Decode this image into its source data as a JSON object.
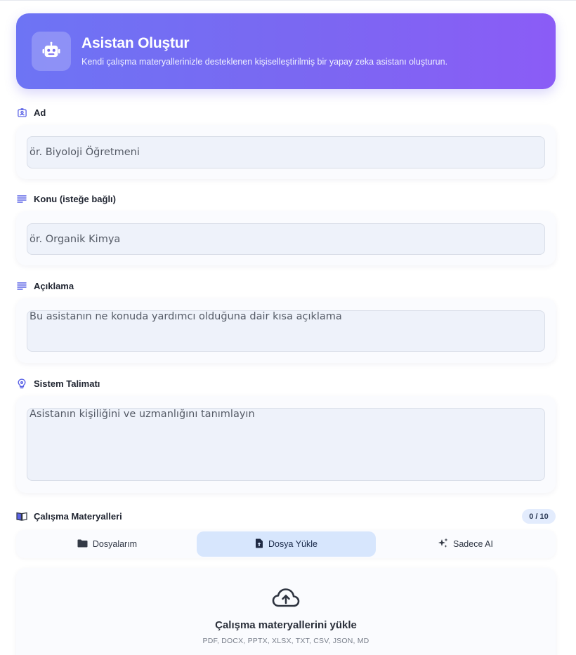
{
  "header": {
    "title": "Asistan Oluştur",
    "subtitle": "Kendi çalışma materyallerinizle desteklenen kişiselleştirilmiş bir yapay zeka asistanı oluşturun.",
    "icon": "robot-icon"
  },
  "fields": {
    "name": {
      "label": "Ad",
      "placeholder": "ör. Biyoloji Öğretmeni",
      "icon": "id-badge-icon"
    },
    "topic": {
      "label": "Konu (isteğe bağlı)",
      "placeholder": "ör. Organik Kimya",
      "icon": "lines-icon"
    },
    "description": {
      "label": "Açıklama",
      "placeholder": "Bu asistanın ne konuda yardımcı olduğuna dair kısa açıklama",
      "icon": "lines-icon"
    },
    "system": {
      "label": "Sistem Talimatı",
      "placeholder": "Asistanın kişiliğini ve uzmanlığını tanımlayın",
      "icon": "lightbulb-icon"
    }
  },
  "materials": {
    "label": "Çalışma Materyalleri",
    "count": "0 / 10",
    "icon": "book-icon",
    "tabs": [
      {
        "label": "Dosyalarım",
        "icon": "folder-icon",
        "active": false
      },
      {
        "label": "Dosya Yükle",
        "icon": "file-upload-icon",
        "active": true
      },
      {
        "label": "Sadece AI",
        "icon": "sparkle-icon",
        "active": false
      }
    ],
    "upload": {
      "title": "Çalışma materyallerini yükle",
      "formats": "PDF, DOCX, PPTX, XLSX, TXT, CSV, JSON, MD",
      "icon": "cloud-upload-icon"
    }
  },
  "colors": {
    "accent": "#7b67f2",
    "accent_icon": "#5b63e6",
    "active_tab": "#d7e6fd"
  }
}
